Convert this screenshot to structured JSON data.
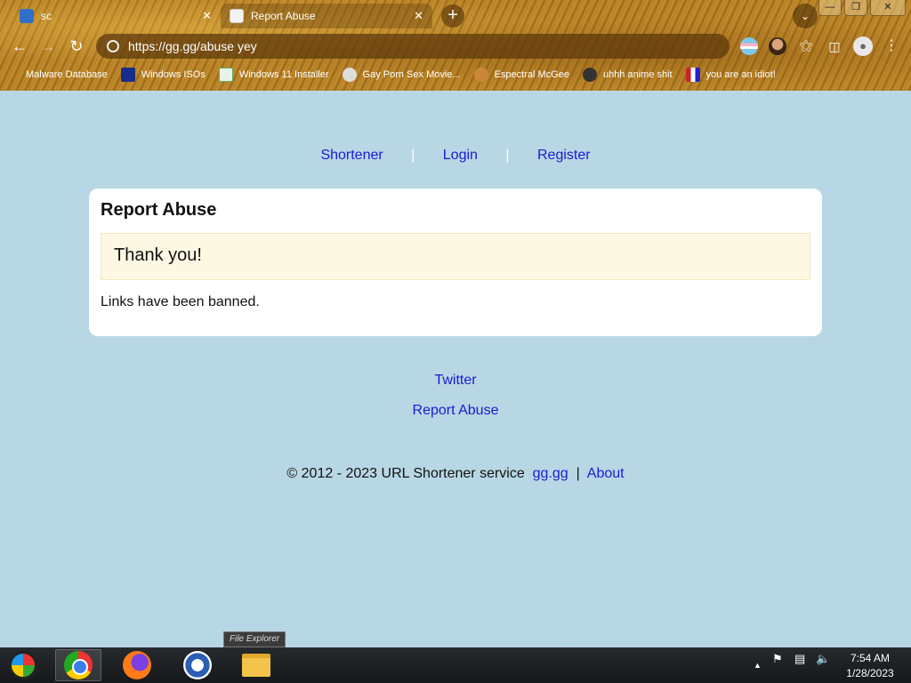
{
  "browser": {
    "tabs": [
      {
        "title": "sc",
        "icon": "telegram-icon"
      },
      {
        "title": "Report Abuse",
        "icon": "page-icon",
        "active": true
      }
    ],
    "new_tab": "+",
    "tab_close": "✕",
    "address": "https://gg.gg/abuse yey",
    "bookmarks": [
      {
        "label": "Malware Database"
      },
      {
        "label": "Windows ISOs"
      },
      {
        "label": "Windows 11 Installer"
      },
      {
        "label": "Gay Porn Sex Movie..."
      },
      {
        "label": "Espectral McGee"
      },
      {
        "label": "uhhh anime shit"
      },
      {
        "label": "you are an idiot!"
      }
    ]
  },
  "page": {
    "nav": {
      "shortener": "Shortener",
      "login": "Login",
      "register": "Register",
      "separator": "|"
    },
    "card": {
      "title": "Report Abuse",
      "notice": "Thank you!",
      "message": "Links have been banned."
    },
    "footer": {
      "twitter": "Twitter",
      "report_abuse": "Report Abuse",
      "copyright": "© 2012 - 2023 URL Shortener service",
      "site_link": "gg.gg",
      "divider": "|",
      "about": "About"
    }
  },
  "taskbar": {
    "tooltip": "File Explorer",
    "clock_time": "7:54 AM",
    "clock_date": "1/28/2023"
  }
}
